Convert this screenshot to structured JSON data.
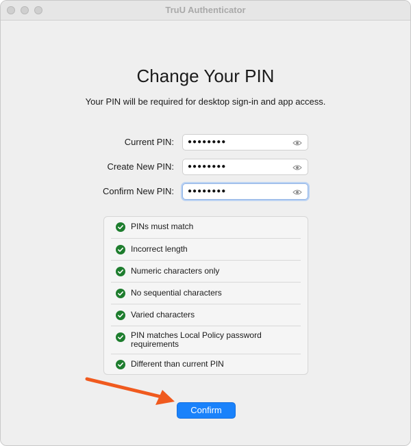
{
  "window": {
    "title": "TruU Authenticator"
  },
  "main": {
    "heading": "Change Your PIN",
    "subheading": "Your PIN will be required for desktop sign-in and app access."
  },
  "fields": {
    "current": {
      "label": "Current PIN:",
      "value": "●●●●●●●●"
    },
    "create": {
      "label": "Create New PIN:",
      "value": "●●●●●●●●"
    },
    "confirm": {
      "label": "Confirm New PIN:",
      "value": "●●●●●●●●"
    }
  },
  "requirements": [
    {
      "text": "PINs must match",
      "status": "passed"
    },
    {
      "text": "Incorrect length",
      "status": "passed"
    },
    {
      "text": "Numeric characters only",
      "status": "passed"
    },
    {
      "text": "No sequential characters",
      "status": "passed"
    },
    {
      "text": "Varied characters",
      "status": "passed"
    },
    {
      "text": "PIN matches Local Policy password requirements",
      "status": "passed"
    },
    {
      "text": "Different than current PIN",
      "status": "passed"
    }
  ],
  "actions": {
    "confirm_label": "Confirm"
  },
  "icons": {
    "reveal": "eye-icon",
    "check": "check-circle-icon",
    "annotation": "arrow-icon"
  },
  "colors": {
    "accent": "#1a82fb",
    "check": "#1e7d2e",
    "annotation_arrow": "#f05a1e"
  }
}
